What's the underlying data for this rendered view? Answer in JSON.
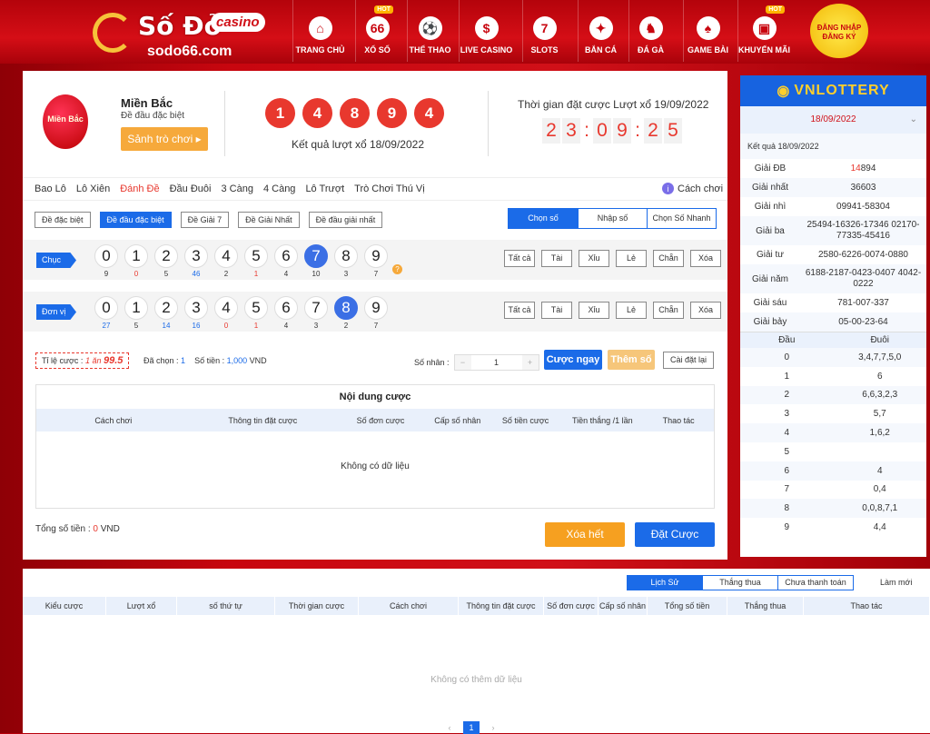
{
  "header": {
    "logo_main": "Số Đỏ",
    "logo_badge": "casino",
    "logo_url": "sodo66.com",
    "nav": [
      {
        "label": "TRANG CHỦ",
        "icon": "home-icon",
        "glyph": "⌂",
        "hot": ""
      },
      {
        "label": "XỔ SỐ",
        "icon": "lottery-icon",
        "glyph": "66",
        "hot": "HOT"
      },
      {
        "label": "THỂ THAO",
        "icon": "soccer-icon",
        "glyph": "⚽",
        "hot": ""
      },
      {
        "label": "LIVE CASINO",
        "icon": "casino-icon",
        "glyph": "$",
        "hot": ""
      },
      {
        "label": "SLOTS",
        "icon": "slots-icon",
        "glyph": "7",
        "hot": ""
      },
      {
        "label": "BẮN CÁ",
        "icon": "fish-icon",
        "glyph": "✦",
        "hot": ""
      },
      {
        "label": "ĐÁ GÀ",
        "icon": "rooster-icon",
        "glyph": "♞",
        "hot": ""
      },
      {
        "label": "GAME BÀI",
        "icon": "cards-icon",
        "glyph": "♠",
        "hot": ""
      },
      {
        "label": "KHUYẾN MÃI",
        "icon": "gift-icon",
        "glyph": "▣",
        "hot": "HOT"
      }
    ],
    "login": "ĐĂNG NHẬP ĐĂNG KÝ"
  },
  "game": {
    "region_icon_text": "Miền Bắc",
    "region": "Miền Bắc",
    "subtitle": "Đề đầu đặc biệt",
    "lobby_button": "Sảnh trò chơi ▸",
    "result_balls": [
      "1",
      "4",
      "8",
      "9",
      "4"
    ],
    "result_label": "Kết quả lượt xổ 18/09/2022",
    "time_left_label": "Thời gian đặt cược Lượt xổ 19/09/2022",
    "countdown": [
      "2",
      "3",
      ":",
      "0",
      "9",
      ":",
      "2",
      "5"
    ]
  },
  "tabs": [
    "Bao Lô",
    "Lô Xiên",
    "Đánh Đề",
    "Đầu Đuôi",
    "3 Càng",
    "4 Càng",
    "Lô Trượt",
    "Trò Chơi Thú Vị"
  ],
  "active_tab": "Đánh Đề",
  "how_to": "Cách chơi",
  "subtabs": [
    "Đề đặc biệt",
    "Đề đầu đặc biệt",
    "Đề Giải 7",
    "Đề Giải Nhất",
    "Đề đầu giải nhất"
  ],
  "active_subtab": "Đề đầu đặc biệt",
  "modes": [
    "Chọn số",
    "Nhập số",
    "Chọn Số Nhanh"
  ],
  "rows": [
    {
      "label": "Chục",
      "digits": [
        "0",
        "1",
        "2",
        "3",
        "4",
        "5",
        "6",
        "7",
        "8",
        "9"
      ],
      "counts": [
        "9",
        "0",
        "5",
        "46",
        "2",
        "1",
        "4",
        "10",
        "3",
        "7"
      ],
      "count_colors": [
        "",
        "red",
        "",
        "blue",
        "",
        "red",
        "",
        "",
        "",
        ""
      ],
      "selected": "7"
    },
    {
      "label": "Đơn vị",
      "digits": [
        "0",
        "1",
        "2",
        "3",
        "4",
        "5",
        "6",
        "7",
        "8",
        "9"
      ],
      "counts": [
        "27",
        "5",
        "14",
        "16",
        "0",
        "1",
        "4",
        "3",
        "2",
        "7"
      ],
      "count_colors": [
        "blue",
        "",
        "blue",
        "blue",
        "red",
        "red",
        "",
        "",
        "",
        ""
      ],
      "selected": "8"
    }
  ],
  "quick_buttons": [
    "Tất cả",
    "Tài",
    "Xỉu",
    "Lẻ",
    "Chẵn",
    "Xóa"
  ],
  "bet": {
    "rate_label": "Tỉ lệ cược :",
    "rate_value": "1 ăn",
    "rate_big": "99.5",
    "picked_label": "Đã chọn :",
    "picked_value": "1",
    "amount_label": "Số tiền :",
    "amount_value": "1,000",
    "amount_unit": "VND",
    "multiplier_label": "Số nhân :",
    "multiplier_value": "1",
    "bet_now": "Cược ngay",
    "add_number": "Thêm số",
    "reset": "Cài đặt lại"
  },
  "content": {
    "title": "Nội dung cược",
    "headers": [
      "Cách chơi",
      "Thông tin đặt cược",
      "Số đơn cược",
      "Cấp số nhân",
      "Số tiền cược",
      "Tiền thắng /1 lần",
      "Thao tác"
    ],
    "empty": "Không có dữ liệu"
  },
  "total": {
    "label": "Tổng số tiền :",
    "value": "0",
    "unit": "VND"
  },
  "actions": {
    "clear": "Xóa hết",
    "place": "Đặt Cược"
  },
  "sidebar": {
    "brand": "VNLOTTERY",
    "date": "18/09/2022",
    "result_date": "Kết quả 18/09/2022",
    "prizes": [
      {
        "name": "Giải ĐB",
        "value_red": "14",
        "value": "894"
      },
      {
        "name": "Giải nhất",
        "value_red": "",
        "value": "36603"
      },
      {
        "name": "Giải nhì",
        "value_red": "",
        "value": "09941-58304"
      },
      {
        "name": "Giải ba",
        "value_red": "",
        "value": "25494-16326-17346 02170-77335-45416"
      },
      {
        "name": "Giải tư",
        "value_red": "",
        "value": "2580-6226-0074-0880"
      },
      {
        "name": "Giải năm",
        "value_red": "",
        "value": "6188-2187-0423-0407 4042-0222"
      },
      {
        "name": "Giải sáu",
        "value_red": "",
        "value": "781-007-337"
      },
      {
        "name": "Giải bảy",
        "value_red": "",
        "value": "05-00-23-64"
      }
    ],
    "head_label": "Đầu",
    "tail_label": "Đuôi",
    "heads": [
      {
        "d": "0",
        "t": "3,4,7,7,5,0"
      },
      {
        "d": "1",
        "t": "6"
      },
      {
        "d": "2",
        "t": "6,6,3,2,3"
      },
      {
        "d": "3",
        "t": "5,7"
      },
      {
        "d": "4",
        "t": "1,6,2"
      },
      {
        "d": "5",
        "t": ""
      },
      {
        "d": "6",
        "t": "4"
      },
      {
        "d": "7",
        "t": "0,4"
      },
      {
        "d": "8",
        "t": "0,0,8,7,1"
      },
      {
        "d": "9",
        "t": "4,4"
      }
    ]
  },
  "history": {
    "tabs": [
      "Lịch Sử",
      "Thắng thua",
      "Chưa thanh toán"
    ],
    "refresh": "Làm mới",
    "headers": [
      "Kiểu cược",
      "Lượt xổ",
      "số thứ tự",
      "Thời gian cược",
      "Cách chơi",
      "Thông tin đặt cược",
      "Số đơn cược",
      "Cấp số nhân",
      "Tổng số tiền",
      "Thắng thua",
      "Thao tác"
    ],
    "empty": "Không có thêm dữ liệu",
    "page": "1"
  },
  "colors": {
    "brand_red": "#d01018",
    "accent_blue": "#1b6be8",
    "accent_orange": "#f6a020"
  }
}
